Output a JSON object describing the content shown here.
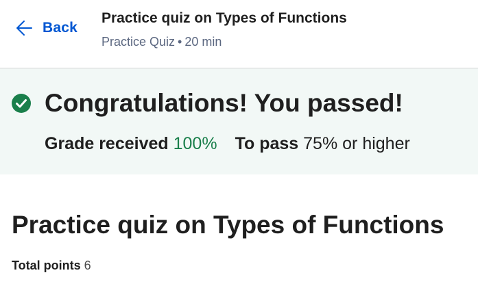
{
  "header": {
    "back_label": "Back",
    "title": "Practice quiz on Types of Functions",
    "type": "Practice Quiz",
    "separator": "•",
    "duration": "20 min"
  },
  "result": {
    "message": "Congratulations! You passed!",
    "grade_label": "Grade received",
    "grade_value": "100%",
    "pass_label": "To pass",
    "pass_value": "75% or higher",
    "status_color": "#1a7f4b"
  },
  "quiz": {
    "title": "Practice quiz on Types of Functions",
    "points_label": "Total points",
    "points_value": "6"
  },
  "icons": {
    "back": "arrow-left-icon",
    "status": "check-circle-icon"
  },
  "colors": {
    "accent": "#0056d2",
    "banner_bg": "#f2f8f6",
    "success": "#1a7f4b"
  }
}
